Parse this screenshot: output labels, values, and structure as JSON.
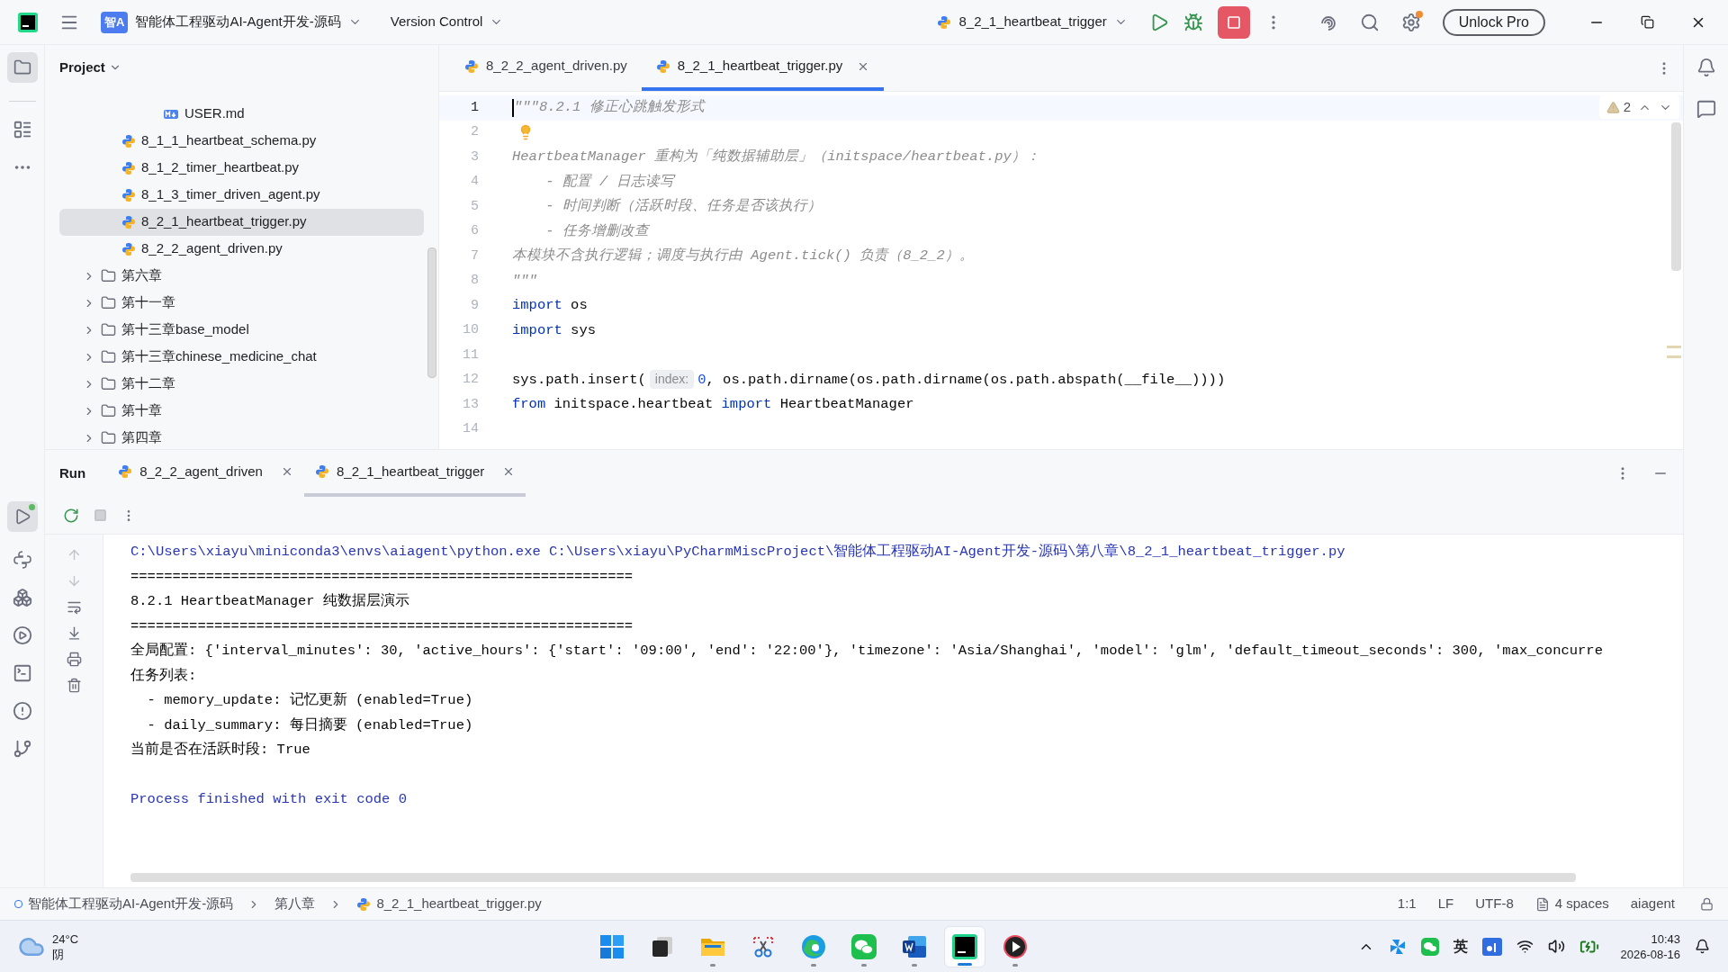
{
  "title_bar": {
    "project_badge": "智A",
    "project": "智能体工程驱动AI-Agent开发-源码",
    "vcs": "Version Control",
    "run_config": "8_2_1_heartbeat_trigger",
    "unlock": "Unlock Pro",
    "settings_notification": true
  },
  "project_panel": {
    "title": "Project",
    "tree": [
      {
        "children": [
          {
            "children": [
              {
                "children": [
                  {
                    "label": "USER.md",
                    "kind": "markdown",
                    "selected": false
                  }
                ]
              }
            ]
          },
          {
            "label": "8_1_1_heartbeat_schema.py",
            "kind": "python",
            "selected": false
          },
          {
            "label": "8_1_2_timer_heartbeat.py",
            "kind": "python",
            "selected": false
          },
          {
            "label": "8_1_3_timer_driven_agent.py",
            "kind": "python",
            "selected": false
          },
          {
            "label": "8_2_1_heartbeat_trigger.py",
            "kind": "python",
            "selected": true
          },
          {
            "label": "8_2_2_agent_driven.py",
            "kind": "python",
            "selected": false
          }
        ]
      },
      {
        "label": "第六章",
        "kind": "folder",
        "expanded": false,
        "selected": false
      },
      {
        "label": "第十一章",
        "kind": "folder",
        "expanded": false,
        "selected": false
      },
      {
        "label": "第十三章base_model",
        "kind": "folder",
        "expanded": false,
        "selected": false
      },
      {
        "label": "第十三章chinese_medicine_chat",
        "kind": "folder",
        "expanded": false,
        "selected": false
      },
      {
        "label": "第十二章",
        "kind": "folder",
        "expanded": false,
        "selected": false
      },
      {
        "label": "第十章",
        "kind": "folder",
        "expanded": false,
        "selected": false
      },
      {
        "label": "第四章",
        "kind": "folder",
        "expanded": false,
        "selected": false
      }
    ]
  },
  "editor": {
    "tabs": [
      {
        "label": "8_2_2_agent_driven.py",
        "selected": false
      },
      {
        "label": "8_2_1_heartbeat_trigger.py",
        "selected": true
      }
    ],
    "warnings": "2",
    "lines": [
      {
        "number": "1",
        "current": true,
        "segments": [
          {
            "kind": "comment",
            "text": "\"\"\"8.2.1 修正心跳触发形式"
          }
        ]
      },
      {
        "number": "2",
        "current": false,
        "bulb": true
      },
      {
        "number": "3",
        "current": false,
        "segments": [
          {
            "kind": "comment",
            "text": "HeartbeatManager 重构为「纯数据辅助层」（initspace/heartbeat.py）："
          }
        ]
      },
      {
        "number": "4",
        "current": false,
        "segments": [
          {
            "kind": "comment",
            "text": "    - 配置 / 日志读写"
          }
        ]
      },
      {
        "number": "5",
        "current": false,
        "segments": [
          {
            "kind": "comment",
            "text": "    - 时间判断（活跃时段、任务是否该执行）"
          }
        ]
      },
      {
        "number": "6",
        "current": false,
        "segments": [
          {
            "kind": "comment",
            "text": "    - 任务增删改查"
          }
        ]
      },
      {
        "number": "7",
        "current": false,
        "segments": [
          {
            "kind": "comment",
            "text": "本模块不含执行逻辑；调度与执行由 Agent.tick() 负责（8_2_2）。"
          }
        ]
      },
      {
        "number": "8",
        "current": false,
        "segments": [
          {
            "kind": "comment",
            "text": "\"\"\""
          }
        ]
      },
      {
        "number": "9",
        "current": false,
        "segments": [
          {
            "kind": "keyword",
            "text": "import"
          },
          {
            "kind": "plain",
            "text": " os"
          }
        ]
      },
      {
        "number": "10",
        "current": false,
        "segments": [
          {
            "kind": "keyword",
            "text": "import"
          },
          {
            "kind": "plain",
            "text": " sys"
          }
        ]
      },
      {
        "number": "11",
        "current": false
      },
      {
        "number": "12",
        "current": false,
        "segments": [
          {
            "kind": "plain",
            "text": "sys.path.insert("
          },
          {
            "kind": "hint",
            "text": "index:"
          },
          {
            "kind": "number",
            "text": "0"
          },
          {
            "kind": "plain",
            "text": ", os.path.dirname(os.path.dirname(os.path.abspath(__file__))))"
          }
        ]
      },
      {
        "number": "13",
        "current": false,
        "segments": [
          {
            "kind": "keyword",
            "text": "from"
          },
          {
            "kind": "plain",
            "text": " initspace.heartbeat "
          },
          {
            "kind": "keyword",
            "text": "import"
          },
          {
            "kind": "plain",
            "text": " HeartbeatManager"
          }
        ]
      },
      {
        "number": "14",
        "current": false
      }
    ]
  },
  "run_panel": {
    "title": "Run",
    "tabs": [
      {
        "label": "8_2_2_agent_driven",
        "selected": false
      },
      {
        "label": "8_2_1_heartbeat_trigger",
        "selected": true
      }
    ],
    "console": [
      {
        "kind": "command",
        "text": "C:\\Users\\xiayu\\miniconda3\\envs\\aiagent\\python.exe C:\\Users\\xiayu\\PyCharmMiscProject\\智能体工程驱动AI-Agent开发-源码\\第八章\\8_2_1_heartbeat_trigger.py"
      },
      {
        "kind": "output",
        "text": "============================================================"
      },
      {
        "kind": "output",
        "text": "8.2.1 HeartbeatManager 纯数据层演示"
      },
      {
        "kind": "output",
        "text": "============================================================"
      },
      {
        "kind": "output",
        "text": "全局配置: {'interval_minutes': 30, 'active_hours': {'start': '09:00', 'end': '22:00'}, 'timezone': 'Asia/Shanghai', 'model': 'glm', 'default_timeout_seconds': 300, 'max_concurre"
      },
      {
        "kind": "output",
        "text": "任务列表:"
      },
      {
        "kind": "output",
        "text": "  - memory_update: 记忆更新 (enabled=True)"
      },
      {
        "kind": "output",
        "text": "  - daily_summary: 每日摘要 (enabled=True)"
      },
      {
        "kind": "output",
        "text": "当前是否在活跃时段: True"
      },
      {
        "kind": "blank"
      },
      {
        "kind": "exit",
        "text": "Process finished with exit code 0"
      }
    ]
  },
  "status_bar": {
    "breadcrumbs": [
      {
        "kind": "project",
        "text": "智能体工程驱动AI-Agent开发-源码"
      },
      {
        "kind": "folder",
        "text": "第八章"
      },
      {
        "kind": "file",
        "text": "8_2_1_heartbeat_trigger.py"
      }
    ],
    "position": "1:1",
    "line_ending": "LF",
    "encoding": "UTF-8",
    "indent": "4 spaces",
    "interpreter": "aiagent"
  },
  "taskbar": {
    "temperature": "24°C",
    "weather": "阴",
    "apps": [
      {
        "kind": "start",
        "running": false,
        "selected": false
      },
      {
        "kind": "taskview",
        "running": false,
        "selected": false
      },
      {
        "kind": "explorer",
        "running": true,
        "selected": false
      },
      {
        "kind": "snip",
        "running": false,
        "selected": false
      },
      {
        "kind": "edge",
        "running": true,
        "selected": false
      },
      {
        "kind": "wechat",
        "running": true,
        "selected": false
      },
      {
        "kind": "word",
        "running": true,
        "selected": false
      },
      {
        "kind": "pycharm",
        "running": true,
        "selected": true
      },
      {
        "kind": "player",
        "running": true,
        "selected": false
      }
    ],
    "ime": "英",
    "time": "10:43",
    "date": "2026-08-16"
  }
}
